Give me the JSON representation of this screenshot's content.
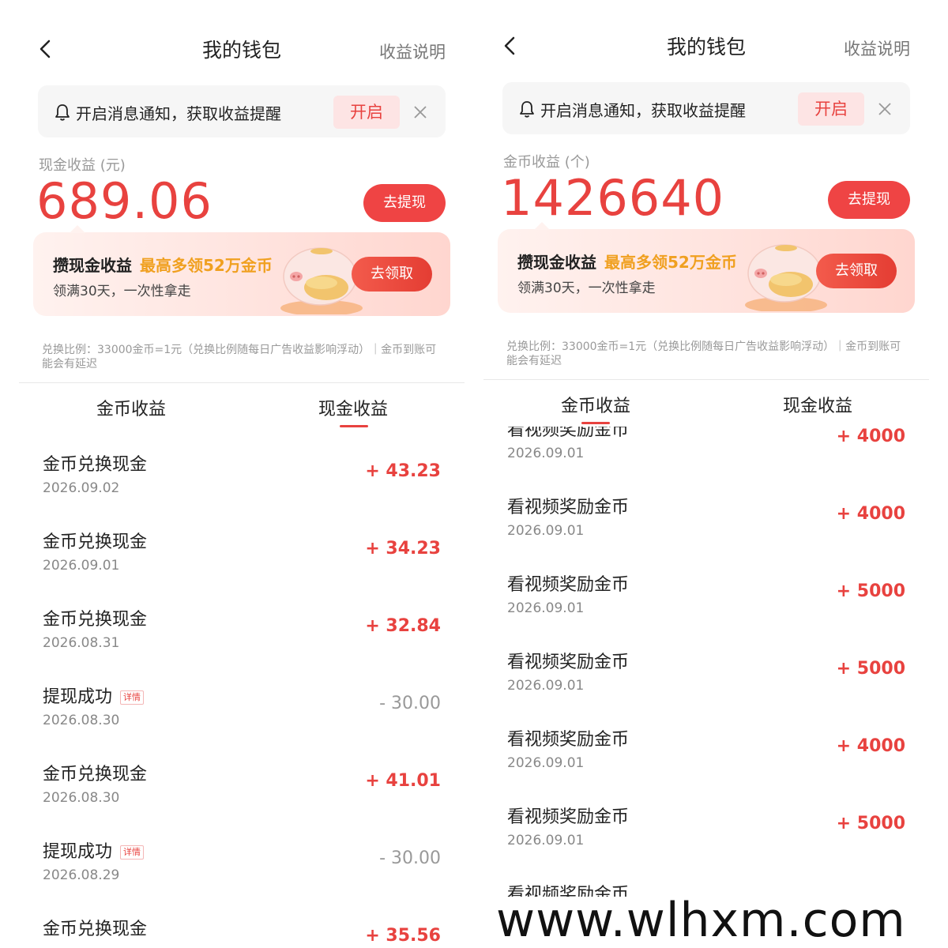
{
  "left": {
    "header": {
      "title": "我的钱包",
      "explain": "收益说明"
    },
    "notice": {
      "text": "开启消息通知，获取收益提醒",
      "button": "开启"
    },
    "balance": {
      "label": "现金收益 (元)",
      "value": "689.06",
      "withdraw": "去提现"
    },
    "promo": {
      "title": "攒现金收益",
      "highlight": "最高多领52万金币",
      "subtitle": "领满30天，一次性拿走",
      "button": "去领取"
    },
    "rate": "兑换比例：33000金币=1元（兑换比例随每日广告收益影响浮动）｜金币到账可能会有延迟",
    "tabs": [
      {
        "label": "金币收益"
      },
      {
        "label": "现金收益"
      }
    ],
    "detail_badge": "详情",
    "rows": [
      {
        "title": "金币兑换现金",
        "date": "2026.09.02",
        "amount": "+ 43.23"
      },
      {
        "title": "金币兑换现金",
        "date": "2026.09.01",
        "amount": "+ 34.23"
      },
      {
        "title": "金币兑换现金",
        "date": "2026.08.31",
        "amount": "+ 32.84"
      },
      {
        "title": "提现成功",
        "date": "2026.08.30",
        "amount": "- 30.00"
      },
      {
        "title": "金币兑换现金",
        "date": "2026.08.30",
        "amount": "+ 41.01"
      },
      {
        "title": "提现成功",
        "date": "2026.08.29",
        "amount": "- 30.00"
      },
      {
        "title": "金币兑换现金",
        "date": "",
        "amount": "+ 35.56"
      }
    ]
  },
  "right": {
    "header": {
      "title": "我的钱包",
      "explain": "收益说明"
    },
    "notice": {
      "text": "开启消息通知，获取收益提醒",
      "button": "开启"
    },
    "balance": {
      "label": "金币收益 (个)",
      "value": "1426640",
      "withdraw": "去提现"
    },
    "promo": {
      "title": "攒现金收益",
      "highlight": "最高多领52万金币",
      "subtitle": "领满30天，一次性拿走",
      "button": "去领取"
    },
    "rate": "兑换比例：33000金币=1元（兑换比例随每日广告收益影响浮动）｜金币到账可能会有延迟",
    "tabs": [
      {
        "label": "金币收益"
      },
      {
        "label": "现金收益"
      }
    ],
    "rows": [
      {
        "title": "看视频奖励金币",
        "date": "2026.09.01",
        "amount": "+ 4000"
      },
      {
        "title": "看视频奖励金币",
        "date": "2026.09.01",
        "amount": "+ 4000"
      },
      {
        "title": "看视频奖励金币",
        "date": "2026.09.01",
        "amount": "+ 5000"
      },
      {
        "title": "看视频奖励金币",
        "date": "2026.09.01",
        "amount": "+ 5000"
      },
      {
        "title": "看视频奖励金币",
        "date": "2026.09.01",
        "amount": "+ 4000"
      },
      {
        "title": "看视频奖励金币",
        "date": "2026.09.01",
        "amount": "+ 5000"
      },
      {
        "title": "看视频奖励金币",
        "date": "",
        "amount": ""
      }
    ]
  },
  "watermark": "www.wlhxm.com",
  "colors": {
    "accent": "#e8423f",
    "highlight": "#f0a020",
    "muted": "#999999"
  }
}
